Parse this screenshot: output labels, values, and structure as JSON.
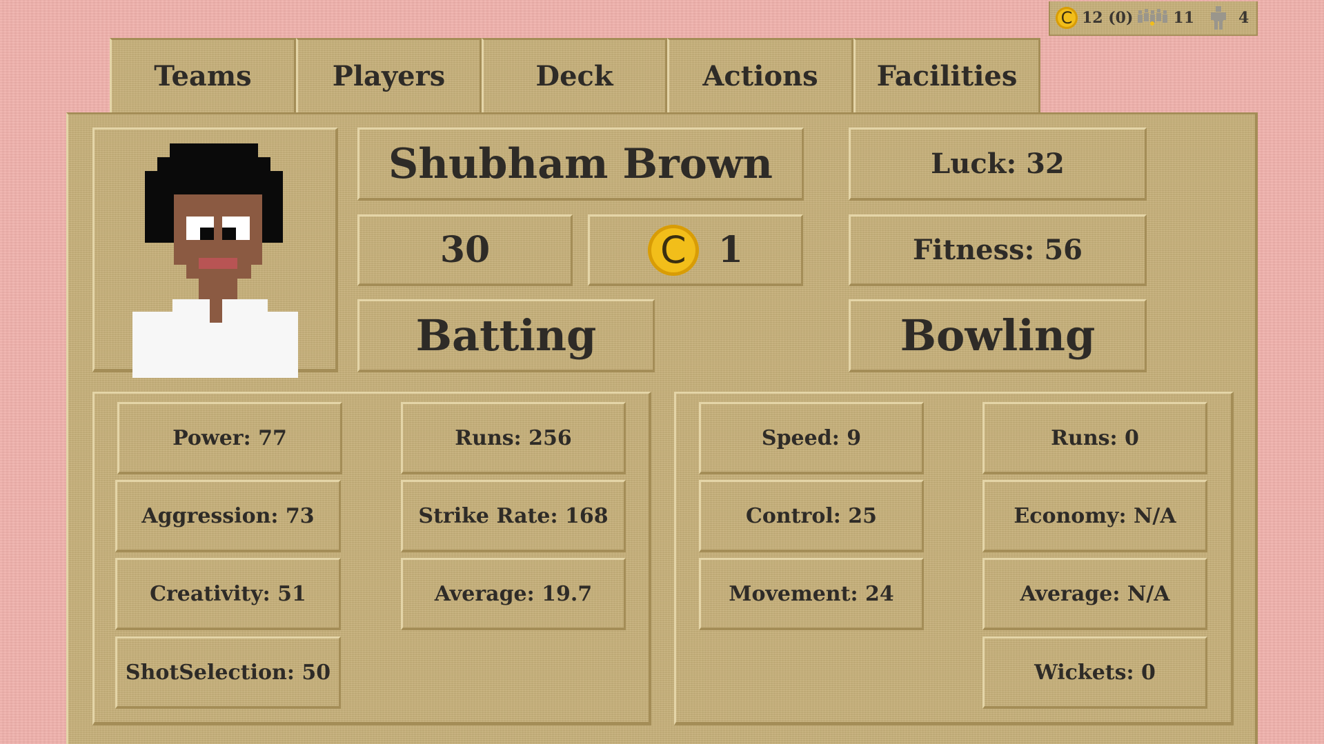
{
  "resources": {
    "coins": "12 (0)",
    "crowd": "11",
    "players": "4",
    "coin_icon": "C"
  },
  "tabs": [
    "Teams",
    "Players",
    "Deck",
    "Actions",
    "Facilities"
  ],
  "player": {
    "name": "Shubham Brown",
    "age": "30",
    "cost": "1",
    "cost_icon": "C",
    "luck": "Luck: 32",
    "fitness": "Fitness: 56"
  },
  "sections": {
    "batting": "Batting",
    "bowling": "Bowling"
  },
  "batting_skills": [
    "Power: 77",
    "Aggression: 73",
    "Creativity: 51",
    "ShotSelection: 50"
  ],
  "batting_stats": [
    "Runs: 256",
    "Strike Rate: 168",
    "Average: 19.7"
  ],
  "bowling_skills": [
    "Speed: 9",
    "Control: 25",
    "Movement: 24"
  ],
  "bowling_stats": [
    "Runs: 0",
    "Economy: N/A",
    "Average: N/A",
    "Wickets: 0"
  ],
  "colors": {
    "background": "#efb0ab",
    "panel": "#c9b27c",
    "coin": "#f2be1a",
    "text": "#2e2b27"
  }
}
